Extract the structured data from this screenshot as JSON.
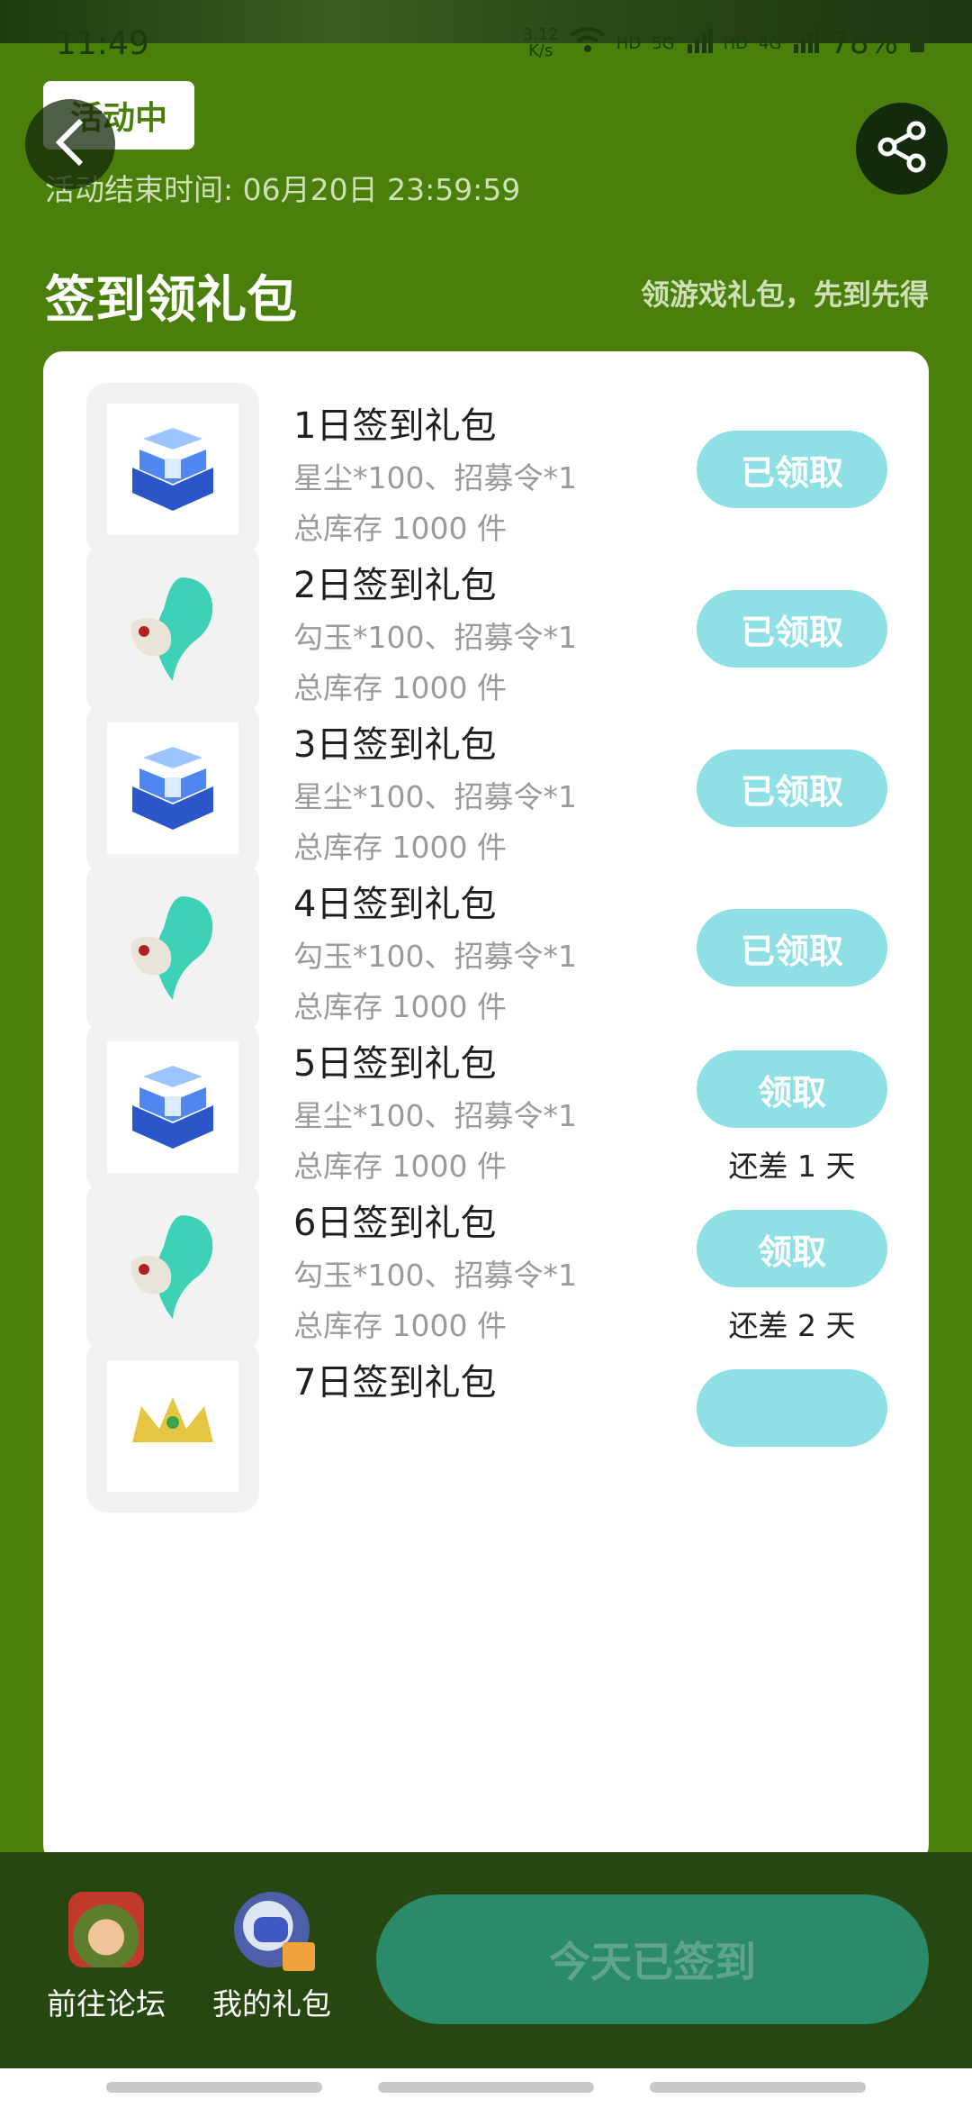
{
  "status": {
    "time": "11:49",
    "speed_top": "3.12",
    "speed_unit": "K/s",
    "hd1": "HD",
    "net1": "5G",
    "hd2": "HD",
    "net2": "4G",
    "battery": "78%"
  },
  "header": {
    "tag": "活动中",
    "end_time": "活动结束时间: 06月20日 23:59:59",
    "title": "签到领礼包",
    "subtitle": "领游戏礼包，先到先得"
  },
  "gifts": [
    {
      "title": "1日签到礼包",
      "desc": "星尘*100、招募令*1",
      "stock": "总库存 1000 件",
      "button": "已领取",
      "note": "",
      "icon": "chest-icon"
    },
    {
      "title": "2日签到礼包",
      "desc": "勾玉*100、招募令*1",
      "stock": "总库存 1000 件",
      "button": "已领取",
      "note": "",
      "icon": "magatama-icon"
    },
    {
      "title": "3日签到礼包",
      "desc": "星尘*100、招募令*1",
      "stock": "总库存 1000 件",
      "button": "已领取",
      "note": "",
      "icon": "chest-icon"
    },
    {
      "title": "4日签到礼包",
      "desc": "勾玉*100、招募令*1",
      "stock": "总库存 1000 件",
      "button": "已领取",
      "note": "",
      "icon": "magatama-icon"
    },
    {
      "title": "5日签到礼包",
      "desc": "星尘*100、招募令*1",
      "stock": "总库存 1000 件",
      "button": "领取",
      "note": "还差 1 天",
      "icon": "chest-icon"
    },
    {
      "title": "6日签到礼包",
      "desc": "勾玉*100、招募令*1",
      "stock": "总库存 1000 件",
      "button": "领取",
      "note": "还差 2 天",
      "icon": "magatama-icon"
    },
    {
      "title": "7日签到礼包",
      "desc": "",
      "stock": "",
      "button": "",
      "note": "",
      "icon": "crown-icon"
    }
  ],
  "bottom": {
    "forum": "前往论坛",
    "my_gifts": "我的礼包",
    "checkin": "今天已签到"
  },
  "colors": {
    "background": "#4a7f0b",
    "button": "#8fe0e4",
    "checkin": "#2a8a6a"
  }
}
